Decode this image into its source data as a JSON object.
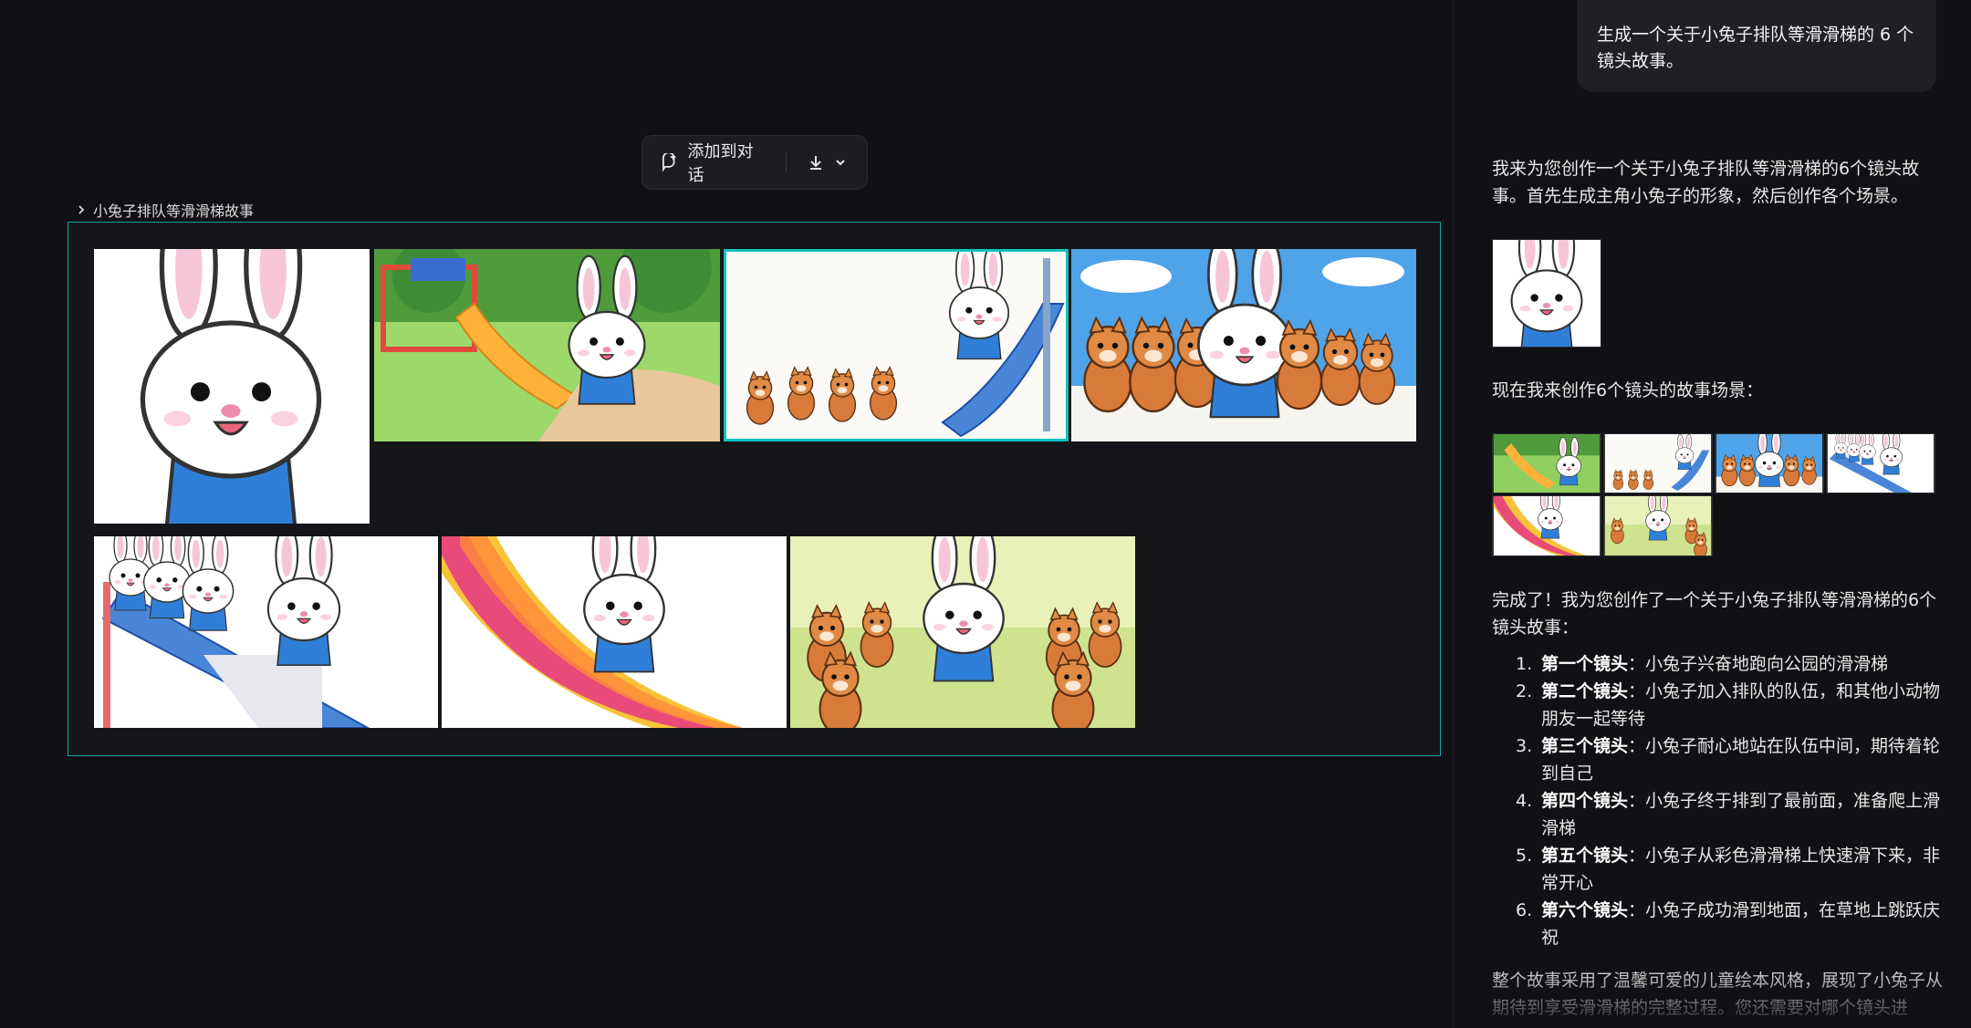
{
  "toolbar": {
    "add_label": "添加到对话"
  },
  "canvas": {
    "group_title": "小兔子排队等滑滑梯故事",
    "images": [
      {
        "name": "rabbit-portrait",
        "scene": "portrait"
      },
      {
        "name": "rabbit-run-playground",
        "scene": "playground"
      },
      {
        "name": "animals-queue-slide",
        "scene": "queue"
      },
      {
        "name": "rabbit-middle-of-line",
        "scene": "lineup"
      },
      {
        "name": "rabbit-climb-stairs",
        "scene": "stairs"
      },
      {
        "name": "rabbit-slide-down",
        "scene": "rainbow"
      },
      {
        "name": "rabbit-celebrate-grass",
        "scene": "celebrate"
      }
    ]
  },
  "chat": {
    "user_message": "生成一个关于小兔子排队等滑滑梯的 6 个镜头故事。",
    "assistant_intro": "我来为您创作一个关于小兔子排队等滑滑梯的6个镜头故事。首先生成主角小兔子的形象，然后创作各个场景。",
    "assistant_scenes": "现在我来创作6个镜头的故事场景：",
    "assistant_done": "完成了！我为您创作了一个关于小兔子排队等滑滑梯的6个镜头故事：",
    "story_items": [
      {
        "num": "1.",
        "title": "第一个镜头",
        "text": "：小兔子兴奋地跑向公园的滑滑梯"
      },
      {
        "num": "2.",
        "title": "第二个镜头",
        "text": "：小兔子加入排队的队伍，和其他小动物朋友一起等待"
      },
      {
        "num": "3.",
        "title": "第三个镜头",
        "text": "：小兔子耐心地站在队伍中间，期待着轮到自己"
      },
      {
        "num": "4.",
        "title": "第四个镜头",
        "text": "：小兔子终于排到了最前面，准备爬上滑滑梯"
      },
      {
        "num": "5.",
        "title": "第五个镜头",
        "text": "：小兔子从彩色滑滑梯上快速滑下来，非常开心"
      },
      {
        "num": "6.",
        "title": "第六个镜头",
        "text": "：小兔子成功滑到地面，在草地上跳跃庆祝"
      }
    ],
    "assistant_summary": "整个故事采用了温馨可爱的儿童绘本风格，展现了小兔子从期待到享受滑滑梯的完整过程。您还需要对哪个镜头进"
  },
  "icons": {
    "add": "add-to-chat-icon",
    "download": "download-icon",
    "chevron": "chevron-down-icon",
    "group": "chevron-right-icon"
  },
  "colors": {
    "accent": "#11a6a3",
    "selected": "#0ec2c0"
  }
}
